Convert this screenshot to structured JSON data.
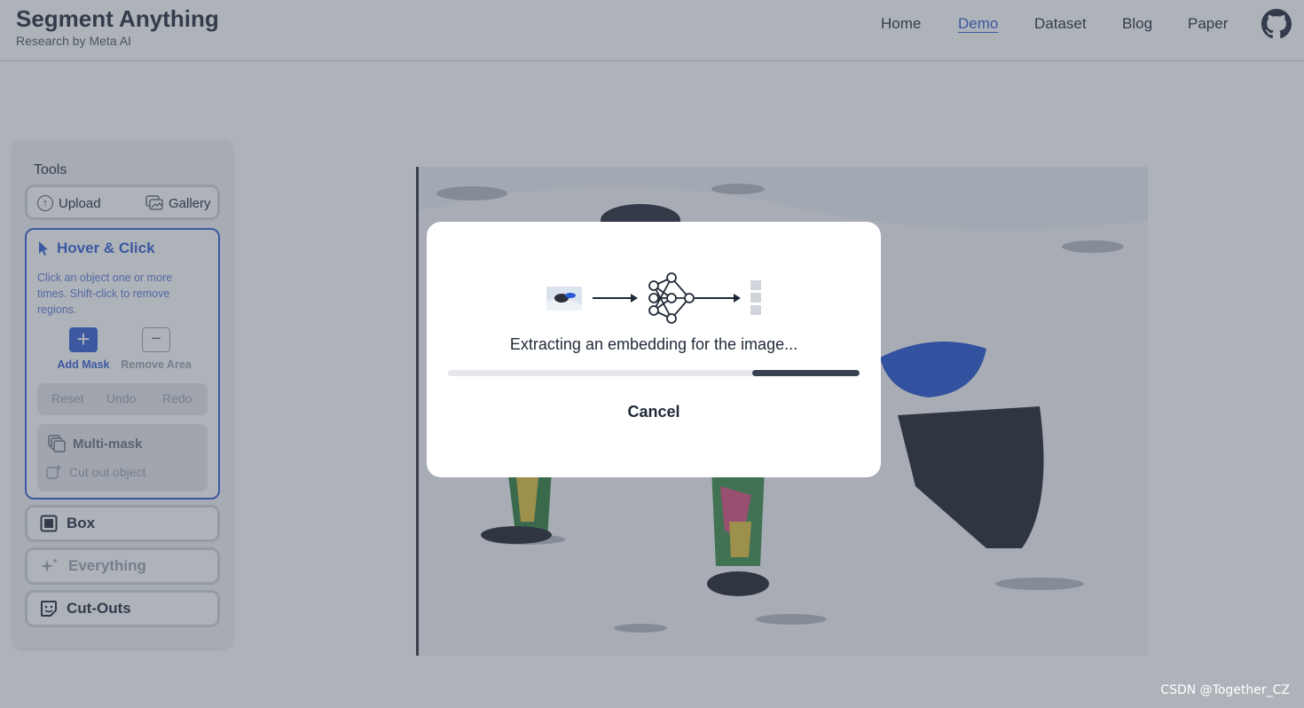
{
  "header": {
    "title": "Segment Anything",
    "subtitle": "Research by Meta AI",
    "nav": [
      "Home",
      "Demo",
      "Dataset",
      "Blog",
      "Paper"
    ],
    "active_nav": "Demo",
    "github_icon": "github-icon"
  },
  "sidebar": {
    "title": "Tools",
    "upload_label": "Upload",
    "gallery_label": "Gallery",
    "hover_click": {
      "title": "Hover & Click",
      "description": "Click an object one or more times. Shift-click to remove regions.",
      "add_mask_label": "Add Mask",
      "remove_area_label": "Remove Area",
      "reset_label": "Reset",
      "undo_label": "Undo",
      "redo_label": "Redo",
      "multimask_label": "Multi-mask",
      "cut_out_label": "Cut out object"
    },
    "box_label": "Box",
    "everything_label": "Everything",
    "cutouts_label": "Cut-Outs"
  },
  "modal": {
    "message": "Extracting an embedding for the image...",
    "progress": 0.74,
    "cancel_label": "Cancel"
  },
  "watermark": "CSDN @Together_CZ",
  "colors": {
    "accent": "#2f5bd3",
    "overlay": "#4b5563",
    "progress": "#374151"
  }
}
